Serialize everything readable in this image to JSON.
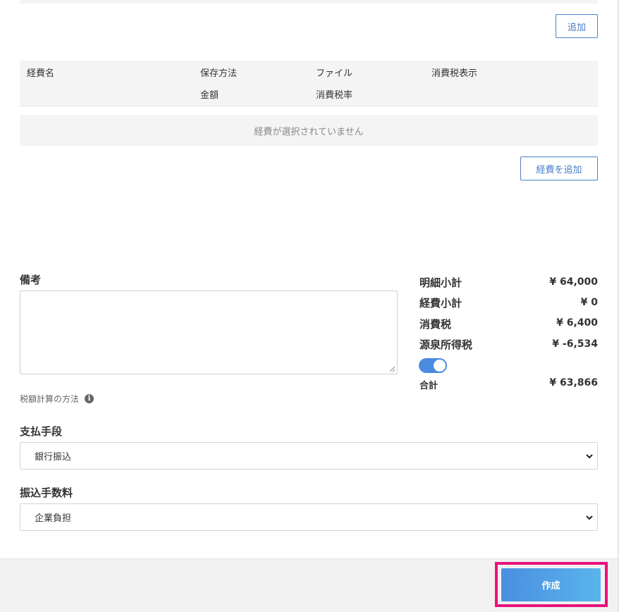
{
  "buttons": {
    "add_label": "追加",
    "add_expense_label": "経費を追加",
    "create_label": "作成"
  },
  "expense_table": {
    "headers_row1": [
      "経費名",
      "保存方法",
      "ファイル",
      "消費税表示"
    ],
    "headers_row2": [
      "金額",
      "消費税率"
    ],
    "empty_message": "経費が選択されていません"
  },
  "notes": {
    "label": "備考",
    "value": ""
  },
  "tax_calc": {
    "label": "税額計算の方法",
    "icon": "info-icon"
  },
  "summary": {
    "items": [
      {
        "label": "明細小計",
        "value": "¥ 64,000"
      },
      {
        "label": "経費小計",
        "value": "¥ 0"
      },
      {
        "label": "消費税",
        "value": "¥ 6,400"
      },
      {
        "label": "源泉所得税",
        "value": "¥ -6,534"
      }
    ],
    "withholding_toggle_on": true,
    "total_label": "合計",
    "total_value": "¥ 63,866"
  },
  "payment": {
    "label": "支払手段",
    "selected": "銀行振込"
  },
  "transfer_fee": {
    "label": "振込手数料",
    "selected": "企業負担"
  },
  "colors": {
    "accent": "#4a7fc8",
    "toggle": "#4a8be0",
    "highlight": "#e8117a"
  }
}
